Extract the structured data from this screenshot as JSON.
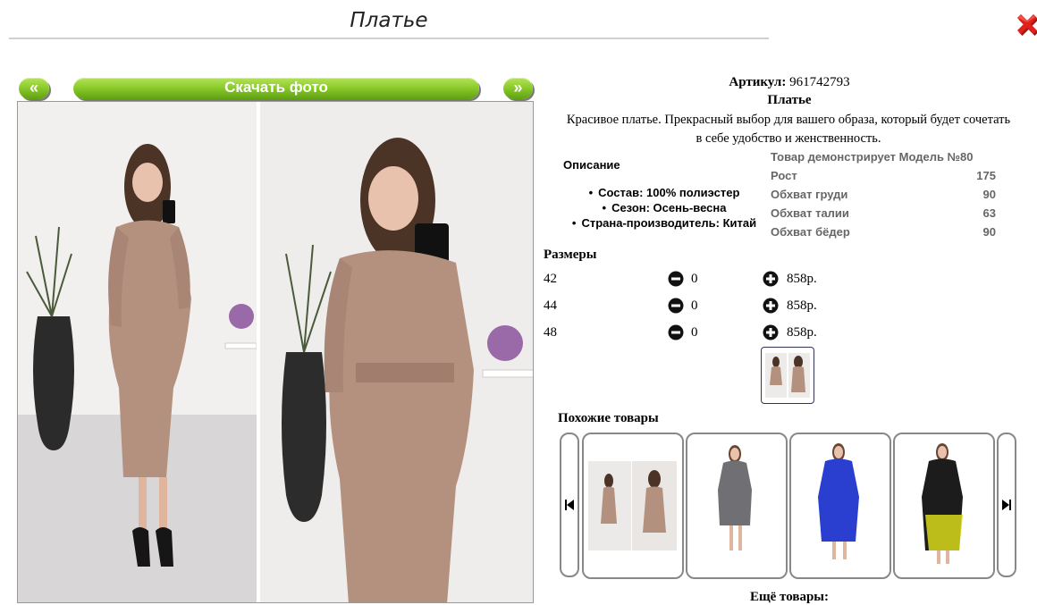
{
  "header": {
    "title": "Платье"
  },
  "gallery": {
    "prev_label": "«",
    "download_label": "Скачать фото",
    "next_label": "»"
  },
  "product": {
    "article_label": "Артикул:",
    "article_value": "961742793",
    "name": "Платье",
    "description_line1": "Красивое платье. Прекрасный выбор для вашего образа, который будет сочетать",
    "description_line2": "в себе удобство и женственность.",
    "details_heading": "Описание",
    "details": [
      "Состав: 100% полиэстер",
      "Сезон: Осень-весна",
      "Страна-производитель: Китай"
    ]
  },
  "model": {
    "title": "Товар демонстрирует Модель №80",
    "rows": [
      {
        "label": "Рост",
        "value": "175"
      },
      {
        "label": "Обхват груди",
        "value": "90"
      },
      {
        "label": "Обхват талии",
        "value": "63"
      },
      {
        "label": "Обхват бёдер",
        "value": "90"
      }
    ]
  },
  "sizes": {
    "heading": "Размеры",
    "rows": [
      {
        "size": "42",
        "qty": "0",
        "price": "858р."
      },
      {
        "size": "44",
        "qty": "0",
        "price": "858р."
      },
      {
        "size": "48",
        "qty": "0",
        "price": "858р."
      }
    ]
  },
  "similar": {
    "heading": "Похожие товары"
  },
  "more": {
    "heading": "Ещё товары:"
  },
  "icons": {
    "close": "close-x-icon",
    "minus": "minus-circle-icon",
    "plus": "plus-circle-icon",
    "carousel_prev": "skip-back-icon",
    "carousel_next": "skip-forward-icon"
  },
  "colors": {
    "button_green": "#8ccc2c",
    "close_red": "#e0201c",
    "dress_beige": "#b4907e",
    "dress_gray": "#6f6f74",
    "dress_blue": "#2a3fd0",
    "dress_yellow": "#d8d81a"
  }
}
